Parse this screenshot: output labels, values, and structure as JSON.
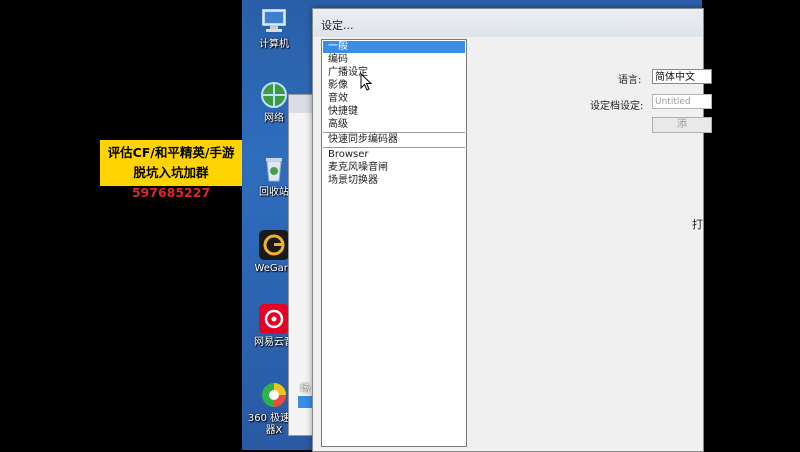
{
  "promo": {
    "line1": "评估CF/和平精英/手游",
    "line2_prefix": "脱坑入坑加群",
    "line2_number": "597685227",
    "bg_color": "#ffd400",
    "number_color": "#e0262b"
  },
  "desktop_icons": [
    {
      "label": "计算机",
      "icon": "computer-icon"
    },
    {
      "label": "网络",
      "icon": "network-icon"
    },
    {
      "label": "回收站",
      "icon": "recycle-bin-icon"
    },
    {
      "label": "WeGam",
      "icon": "wegame-icon"
    },
    {
      "label": "网易云音",
      "icon": "netease-music-icon"
    },
    {
      "label": "360 极速浏",
      "label2": "器X",
      "icon": "360-browser-icon"
    }
  ],
  "dialog": {
    "title": "设定...",
    "categories": [
      {
        "label": "一般",
        "selected": true
      },
      {
        "label": "编码"
      },
      {
        "label": "广播设定"
      },
      {
        "label": "影像"
      },
      {
        "label": "音效"
      },
      {
        "label": "快捷键"
      },
      {
        "label": "高级"
      },
      {
        "label": "快速同步编码器"
      },
      {
        "label": "Browser"
      },
      {
        "label": "麦克风噪音闸"
      },
      {
        "label": "场景切换器"
      }
    ],
    "language_label": "语言:",
    "language_value": "简体中文",
    "profile_label": "设定档设定:",
    "profile_placeholder": "Untitled",
    "add_button": "添",
    "edge_char": "打"
  },
  "taskhint": "场",
  "accent_color": "#3b8ce4"
}
